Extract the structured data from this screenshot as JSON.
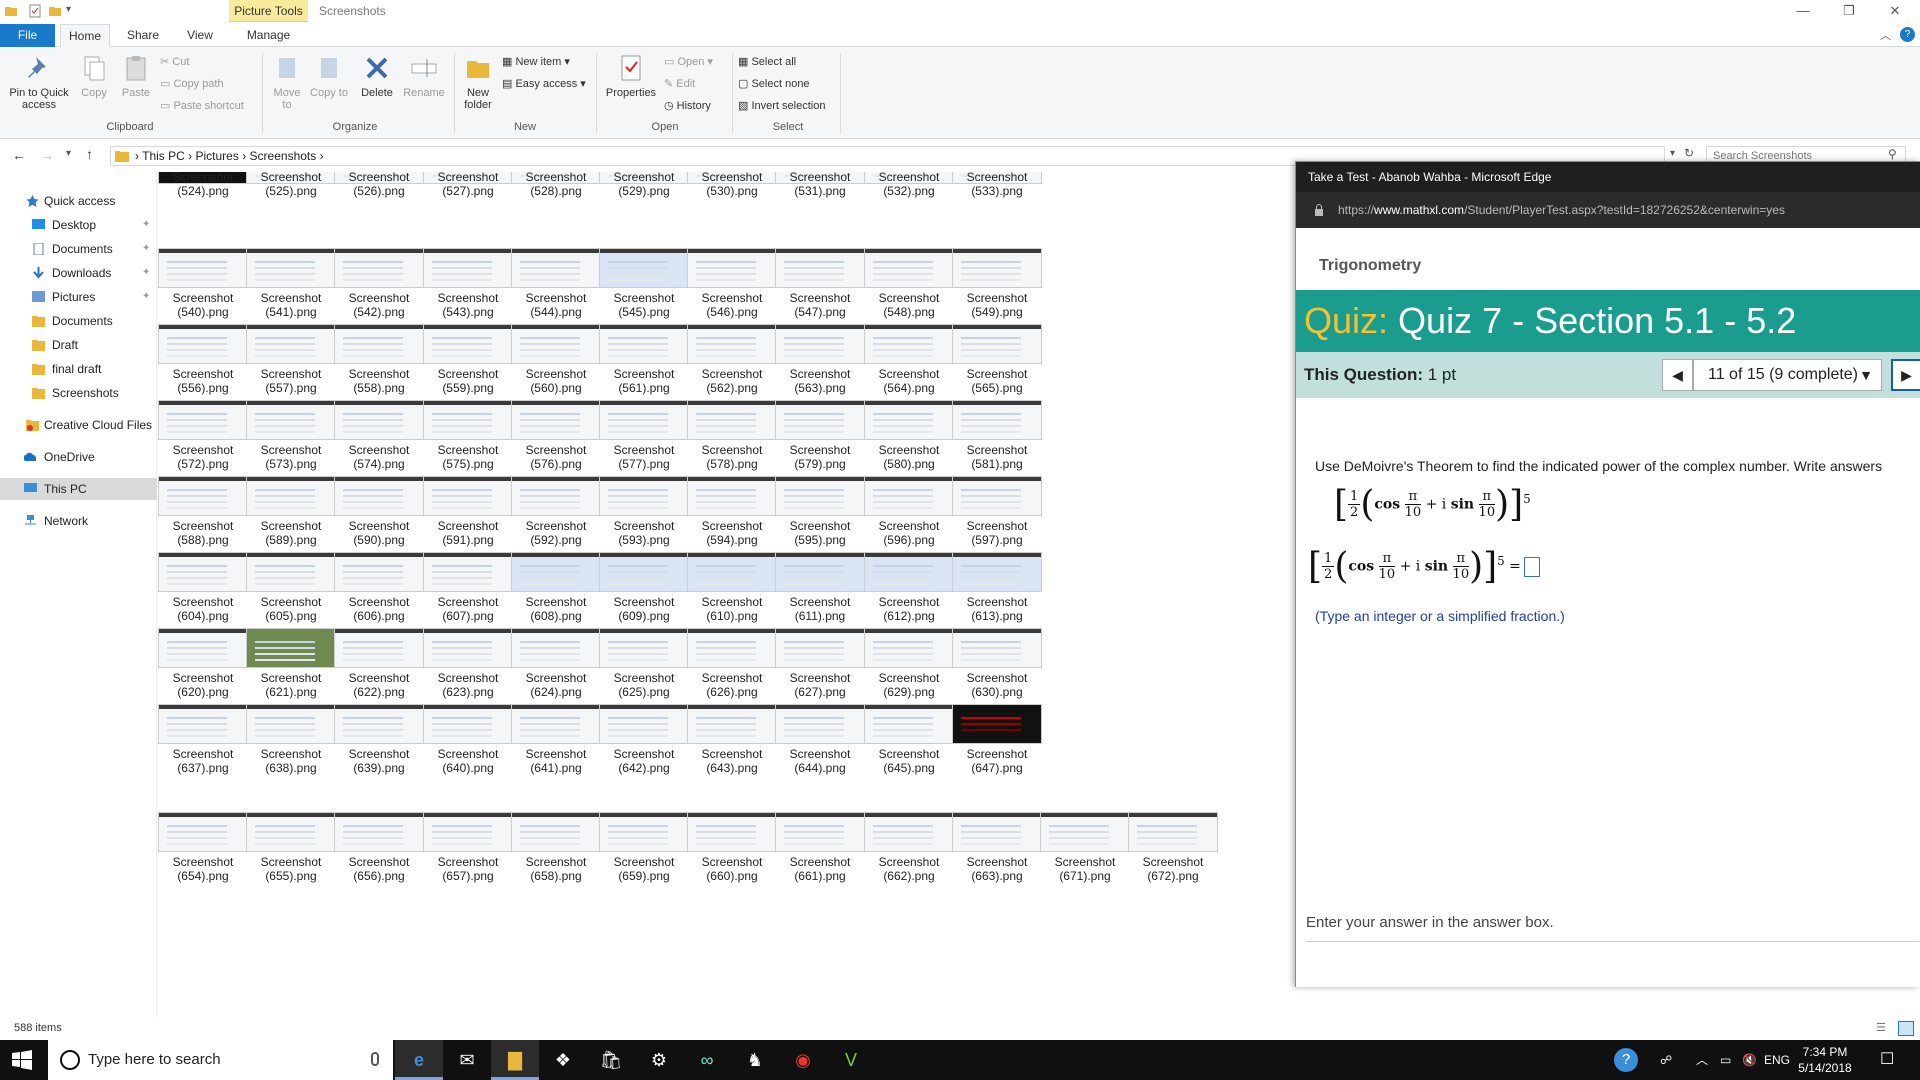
{
  "explorer": {
    "picture_tools_label": "Picture Tools",
    "window_title": "Screenshots",
    "window_controls": [
      "—",
      "❐",
      "✕"
    ],
    "tabs": [
      "File",
      "Home",
      "Share",
      "View",
      "Manage"
    ],
    "ribbon": {
      "pin_label": "Pin to Quick access",
      "copy_label": "Copy",
      "paste_label": "Paste",
      "cut_label": "Cut",
      "copy_path_label": "Copy path",
      "paste_shortcut_label": "Paste shortcut",
      "move_to_label": "Move to",
      "copy_to_label": "Copy to",
      "delete_label": "Delete",
      "rename_label": "Rename",
      "new_folder_label": "New folder",
      "new_item_label": "New item",
      "easy_access_label": "Easy access",
      "properties_label": "Properties",
      "open_label": "Open",
      "edit_label": "Edit",
      "history_label": "History",
      "select_all_label": "Select all",
      "select_none_label": "Select none",
      "invert_selection_label": "Invert selection",
      "groups": [
        "Clipboard",
        "Organize",
        "New",
        "Open",
        "Select"
      ]
    },
    "breadcrumb": [
      "This PC",
      "Pictures",
      "Screenshots"
    ],
    "search_placeholder": "Search Screenshots",
    "nav": {
      "quick_access": "Quick access",
      "desktop": "Desktop",
      "documents": "Documents",
      "downloads": "Downloads",
      "pictures": "Pictures",
      "documents2": "Documents",
      "draft": "Draft",
      "final_draft": "final draft",
      "screenshots": "Screenshots",
      "creative_cloud": "Creative Cloud Files",
      "onedrive": "OneDrive",
      "this_pc": "This PC",
      "network": "Network"
    },
    "file_label": "Screenshot",
    "rows": [
      [
        "(524).png",
        "(525).png",
        "(526).png",
        "(527).png",
        "(528).png",
        "(529).png",
        "(530).png",
        "(531).png",
        "(532).png",
        "(533).png"
      ],
      [
        "(540).png",
        "(541).png",
        "(542).png",
        "(543).png",
        "(544).png",
        "(545).png",
        "(546).png",
        "(547).png",
        "(548).png",
        "(549).png"
      ],
      [
        "(556).png",
        "(557).png",
        "(558).png",
        "(559).png",
        "(560).png",
        "(561).png",
        "(562).png",
        "(563).png",
        "(564).png",
        "(565).png"
      ],
      [
        "(572).png",
        "(573).png",
        "(574).png",
        "(575).png",
        "(576).png",
        "(577).png",
        "(578).png",
        "(579).png",
        "(580).png",
        "(581).png"
      ],
      [
        "(588).png",
        "(589).png",
        "(590).png",
        "(591).png",
        "(592).png",
        "(593).png",
        "(594).png",
        "(595).png",
        "(596).png",
        "(597).png"
      ],
      [
        "(604).png",
        "(605).png",
        "(606).png",
        "(607).png",
        "(608).png",
        "(609).png",
        "(610).png",
        "(611).png",
        "(612).png",
        "(613).png"
      ],
      [
        "(620).png",
        "(621).png",
        "(622).png",
        "(623).png",
        "(624).png",
        "(625).png",
        "(626).png",
        "(627).png",
        "(629).png",
        "(630).png"
      ],
      [
        "(637).png",
        "(638).png",
        "(639).png",
        "(640).png",
        "(641).png",
        "(642).png",
        "(643).png",
        "(644).png",
        "(645).png",
        "(647).png"
      ],
      [
        "(654).png",
        "(655).png",
        "(656).png",
        "(657).png",
        "(658).png",
        "(659).png",
        "(660).png",
        "(661).png",
        "(662).png",
        "(663).png",
        "(671).png",
        "(672).png"
      ]
    ],
    "status_items": "588 items"
  },
  "edge": {
    "title": "Take a Test - Abanob Wahba - Microsoft Edge",
    "url_prefix": "https://",
    "url_domain": "www.mathxl.com",
    "url_path": "/Student/PlayerTest.aspx?testId=182726252&centerwin=yes",
    "course": "Trigonometry",
    "quiz_prefix": "Quiz:",
    "quiz_title": "Quiz 7 - Section 5.1 - 5.2",
    "question_label": "This Question:",
    "question_points": "1 pt",
    "question_selector": "11 of 15 (9 complete)",
    "instruction": "Use DeMoivre's Theorem to find the indicated power of the complex number.  Write answers",
    "math": {
      "half_num": "1",
      "half_den": "2",
      "cos": "cos",
      "sin": "sin",
      "pi": "π",
      "ten": "10",
      "plus_i": "+ i",
      "exponent": "5",
      "equals": "="
    },
    "hint": "(Type an integer or a simplified fraction.)",
    "footer_hint": "Enter your answer in the answer box."
  },
  "taskbar": {
    "search_placeholder": "Type here to search",
    "language": "ENG",
    "time": "7:34 PM",
    "date": "5/14/2018"
  }
}
